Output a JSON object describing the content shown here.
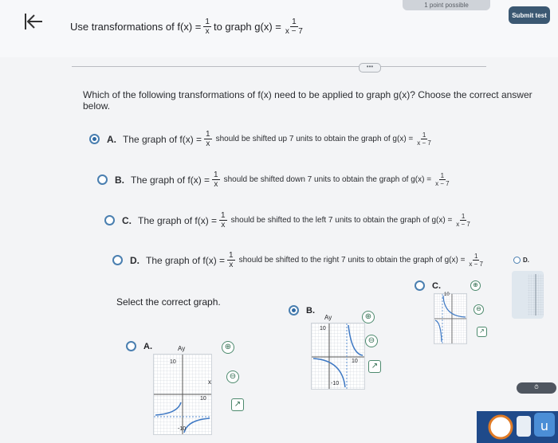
{
  "header": {
    "progress_text": "1 point possible",
    "submit_label": "Submit test"
  },
  "prompt": {
    "text": "Use transformations of",
    "f_lhs": "f(x) =",
    "f_num": "1",
    "f_den": "x",
    "joiner": "to graph",
    "g_lhs": "g(x) =",
    "g_num": "1",
    "g_den": "x − 7"
  },
  "question": "Which of the following transformations of f(x) need to be applied to graph g(x)? Choose the correct answer below.",
  "options": [
    {
      "letter": "A.",
      "lead": "The graph of f(x) =",
      "body": "should be shifted up 7 units to obtain the graph of g(x) =",
      "selected": true
    },
    {
      "letter": "B.",
      "lead": "The graph of f(x) =",
      "body": "should be shifted down 7 units to obtain the graph of g(x) =",
      "selected": false
    },
    {
      "letter": "C.",
      "lead": "The graph of f(x) =",
      "body": "should be shifted to the left 7 units to obtain the graph of g(x) =",
      "selected": false
    },
    {
      "letter": "D.",
      "lead": "The graph of f(x) =",
      "body": "should be shifted to the right 7 units to obtain the graph of g(x) =",
      "selected": false
    }
  ],
  "graph_prompt": "Select the correct graph.",
  "graph_options": [
    {
      "letter": "A.",
      "selected": false,
      "ymax": "10",
      "ymin": "-10",
      "xmax": "10"
    },
    {
      "letter": "B.",
      "selected": true,
      "ymax": "10",
      "ymin": "-10",
      "xmax": "10"
    },
    {
      "letter": "C.",
      "selected": false,
      "ymax": "10"
    },
    {
      "letter": "D.",
      "selected": false
    }
  ],
  "axis_labels": {
    "y": "Ay",
    "x": "x"
  },
  "colors": {
    "accent": "#2f6aa5",
    "tool": "#4d8a6e",
    "submit": "#3b5872"
  }
}
